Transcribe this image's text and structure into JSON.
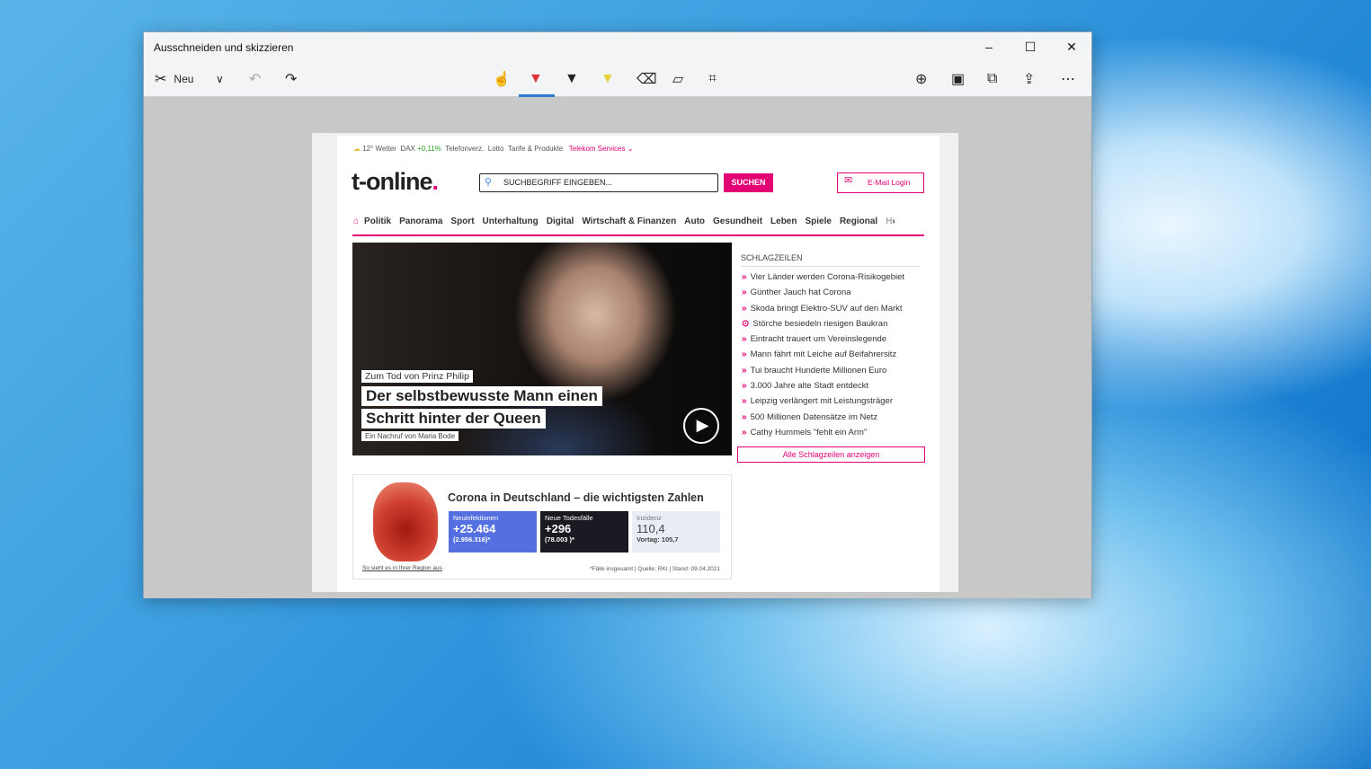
{
  "window": {
    "title": "Ausschneiden und skizzieren",
    "controls": [
      "–",
      "☐",
      "✕"
    ]
  },
  "toolbar": {
    "new_label": "Neu",
    "more": "⋯"
  },
  "site": {
    "topbar": {
      "weather": "12° Wetter",
      "dax_label": "DAX",
      "dax_value": "+0,11%",
      "links": [
        "Telefonverz.",
        "Lotto",
        "Tarife & Produkte"
      ],
      "telekom": "Telekom Services",
      "dax_color": "#2ca02c"
    },
    "logo": "t-online",
    "logo_dot": ".",
    "brand_color": "#e20074",
    "search": {
      "placeholder": "SUCHBEGRIFF EINGEBEN...",
      "button": "SUCHEN"
    },
    "email_login": "E-Mail Login",
    "nav": [
      "Politik",
      "Panorama",
      "Sport",
      "Unterhaltung",
      "Digital",
      "Wirtschaft & Finanzen",
      "Auto",
      "Gesundheit",
      "Leben",
      "Spiele",
      "Regional",
      "H"
    ],
    "hero": {
      "kicker": "Zum Tod von Prinz Philip",
      "title_line1": "Der selbstbewusste Mann einen",
      "title_line2": "Schritt hinter der Queen",
      "byline": "Ein Nachruf von Maria Bode"
    },
    "headlines": {
      "title": "SCHLAGZEILEN",
      "items": [
        "Vier Länder werden Corona-Risikogebiet",
        "Günther Jauch hat Corona",
        "Skoda bringt Elektro-SUV auf den Markt",
        "Störche besiedeln riesigen Baukran",
        "Eintracht trauert um Vereinslegende",
        "Mann fährt mit Leiche auf Beifahrersitz",
        "Tui braucht Hunderte Millionen Euro",
        "3.000 Jahre alte Stadt entdeckt",
        "Leipzig verlängert mit Leistungsträger",
        "500 Millionen Datensätze im Netz",
        "Cathy Hummels \"fehlt ein Arm\""
      ],
      "all": "Alle Schlagzeilen anzeigen"
    },
    "corona": {
      "title": "Corona in Deutschland – die wichtigsten Zahlen",
      "map_link": "So sieht es in Ihrer Region aus",
      "footer": "*Fälle insgesamt | Quelle: RKI | Stand: 09.04.2021",
      "boxes": [
        {
          "label": "Neuinfektionen",
          "value": "+25.464",
          "sub": "(2.956.316)*",
          "color": "#5470e0"
        },
        {
          "label": "Neue Todesfälle",
          "value": "+296",
          "sub": "(78.003 )*",
          "color": "#1a1a22"
        },
        {
          "label": "Inzidenz",
          "value": "110,4",
          "sub": "Vortag: 105,7",
          "color": "#e8edf6"
        }
      ]
    }
  }
}
